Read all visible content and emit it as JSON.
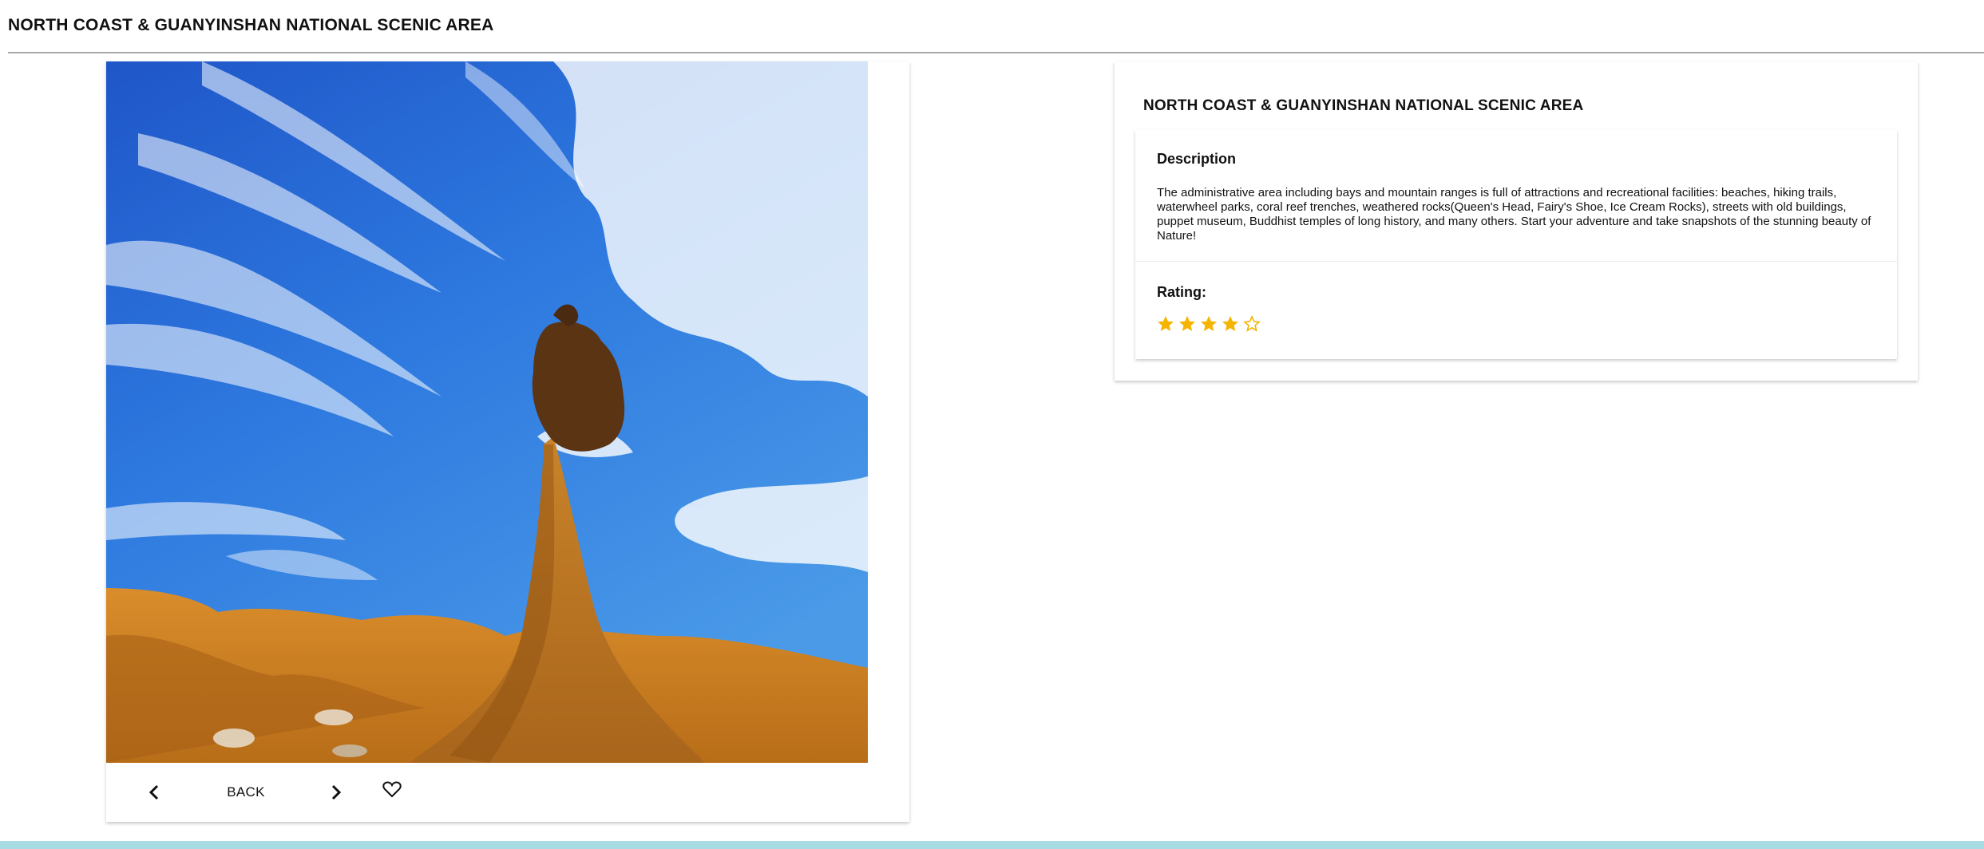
{
  "header": {
    "title": "NORTH COAST & GUANYINSHAN NATIONAL SCENIC AREA"
  },
  "photo_card": {
    "back_label": "BACK",
    "prev_icon": "chevron-left-icon",
    "next_icon": "chevron-right-icon",
    "favorite_icon": "heart-outline-icon"
  },
  "info_card": {
    "title": "NORTH COAST & GUANYINSHAN NATIONAL SCENIC AREA",
    "description_heading": "Description",
    "description_text": "The administrative area including bays and mountain ranges is full of attractions and recreational facilities: beaches, hiking trails, waterwheel parks, coral reef trenches, weathered rocks(Queen's Head, Fairy's Shoe, Ice Cream Rocks), streets with old buildings, puppet museum, Buddhist temples of long history, and many others. Start your adventure and take snapshots of the stunning beauty of Nature!",
    "rating_heading": "Rating:",
    "rating_value": 4,
    "rating_max": 5
  },
  "colors": {
    "star": "#f5b400",
    "bottom_bar": "#a8dce2",
    "divider": "#a8a8a8"
  }
}
